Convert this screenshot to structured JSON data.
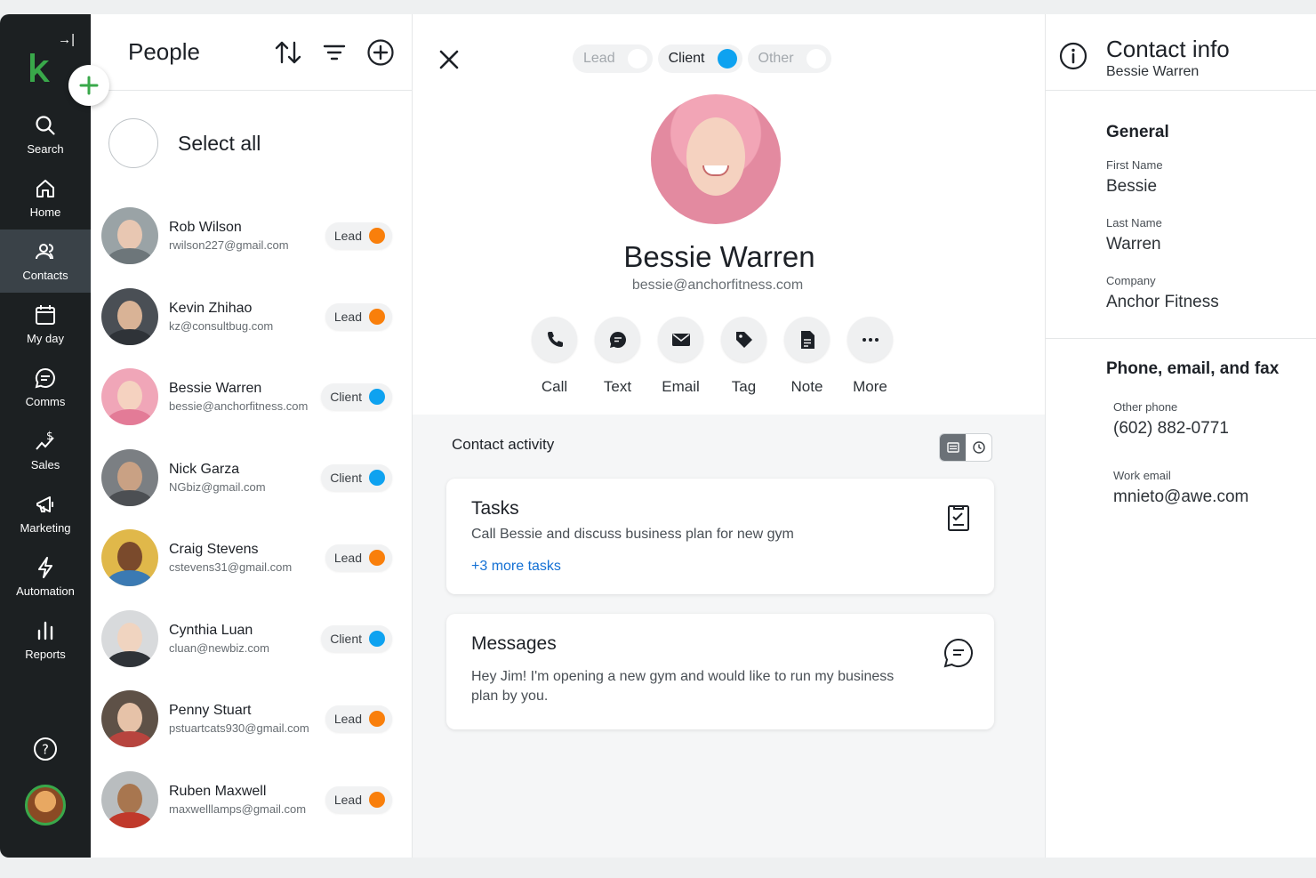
{
  "nav": {
    "items": [
      {
        "label": "Search",
        "icon": "search-icon"
      },
      {
        "label": "Home",
        "icon": "home-icon"
      },
      {
        "label": "Contacts",
        "icon": "contacts-icon",
        "active": true
      },
      {
        "label": "My day",
        "icon": "calendar-icon"
      },
      {
        "label": "Comms",
        "icon": "chat-icon"
      },
      {
        "label": "Sales",
        "icon": "sales-icon"
      },
      {
        "label": "Marketing",
        "icon": "megaphone-icon"
      },
      {
        "label": "Automation",
        "icon": "lightning-icon"
      },
      {
        "label": "Reports",
        "icon": "bar-chart-icon"
      }
    ],
    "brand_color": "#39a84a"
  },
  "people": {
    "title": "People",
    "select_all": "Select all",
    "contacts": [
      {
        "name": "Rob Wilson",
        "email": "rwilson227@gmail.com",
        "status": "Lead"
      },
      {
        "name": "Kevin Zhihao",
        "email": "kz@consultbug.com",
        "status": "Lead"
      },
      {
        "name": "Bessie Warren",
        "email": "bessie@anchorfitness.com",
        "status": "Client"
      },
      {
        "name": "Nick Garza",
        "email": "NGbiz@gmail.com",
        "status": "Client"
      },
      {
        "name": "Craig Stevens",
        "email": "cstevens31@gmail.com",
        "status": "Lead"
      },
      {
        "name": "Cynthia Luan",
        "email": "cluan@newbiz.com",
        "status": "Client"
      },
      {
        "name": "Penny Stuart",
        "email": "pstuartcats930@gmail.com",
        "status": "Lead"
      },
      {
        "name": "Ruben Maxwell",
        "email": "maxwelllamps@gmail.com",
        "status": "Lead"
      }
    ]
  },
  "status_colors": {
    "Lead": "#f97f0b",
    "Client": "#0ea2f0"
  },
  "detail": {
    "status_options": [
      "Lead",
      "Client",
      "Other"
    ],
    "selected_status": "Client",
    "name": "Bessie Warren",
    "email": "bessie@anchorfitness.com",
    "actions": [
      "Call",
      "Text",
      "Email",
      "Tag",
      "Note",
      "More"
    ],
    "activity_title": "Contact activity",
    "tasks": {
      "title": "Tasks",
      "text": "Call Bessie and discuss business plan for new gym",
      "more_link": "+3 more tasks"
    },
    "messages": {
      "title": "Messages",
      "text": "Hey Jim! I'm opening a new gym and would like to run my business plan by you."
    }
  },
  "info": {
    "title": "Contact info",
    "subtitle": "Bessie Warren",
    "general_title": "General",
    "fields": [
      {
        "label": "First Name",
        "value": "Bessie"
      },
      {
        "label": "Last Name",
        "value": "Warren"
      },
      {
        "label": "Company",
        "value": "Anchor Fitness"
      }
    ],
    "phone_title": "Phone, email, and fax",
    "phone_fields": [
      {
        "label": "Other phone",
        "value": "(602) 882-0771"
      },
      {
        "label": "Work email",
        "value": "mnieto@awe.com"
      }
    ]
  }
}
